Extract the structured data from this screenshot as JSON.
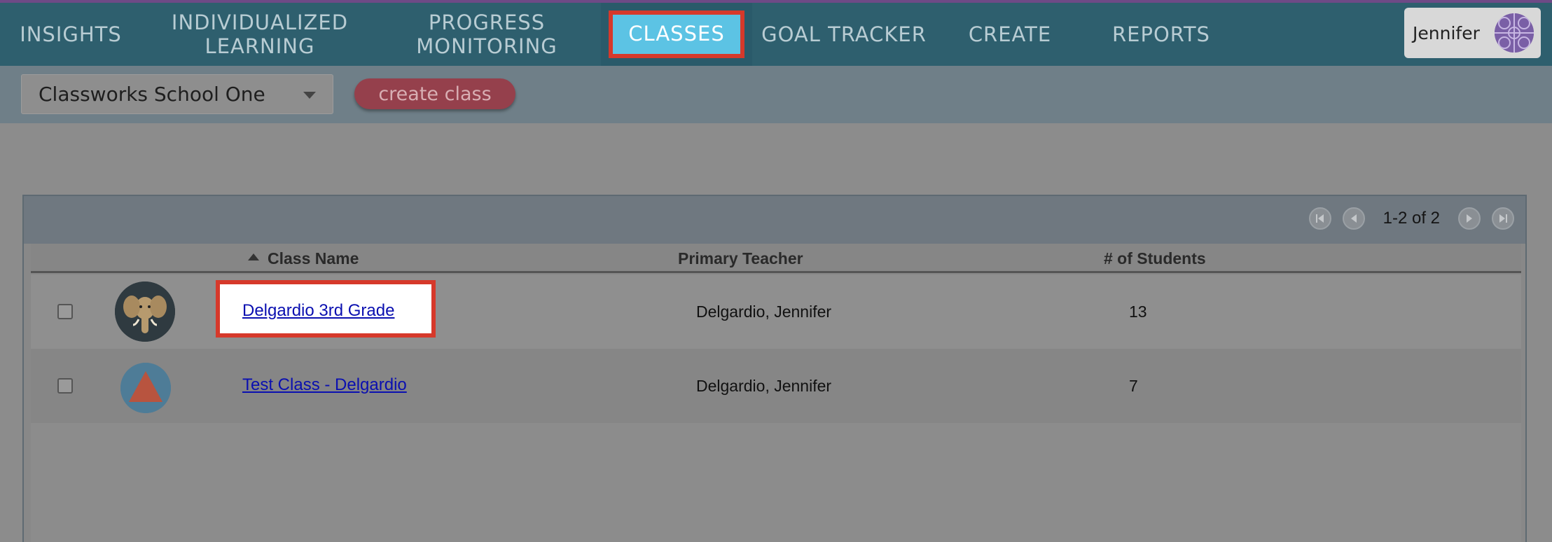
{
  "nav": {
    "items": [
      {
        "label": "INSIGHTS"
      },
      {
        "label": "INDIVIDUALIZED LEARNING"
      },
      {
        "label": "PROGRESS MONITORING"
      },
      {
        "label": "CLASSES"
      },
      {
        "label": "GOAL TRACKER"
      },
      {
        "label": "CREATE"
      },
      {
        "label": "REPORTS"
      }
    ],
    "active": "CLASSES",
    "user": {
      "name": "Jennifer"
    }
  },
  "toolbar": {
    "school_select": {
      "value": "Classworks School One"
    },
    "create_label": "create class"
  },
  "table": {
    "pager_text": "1-2 of 2",
    "headers": {
      "class_name": "Class Name",
      "teacher": "Primary Teacher",
      "students": "# of Students"
    },
    "rows": [
      {
        "class_name": "Delgardio 3rd Grade",
        "teacher": "Delgardio, Jennifer",
        "students": "13",
        "icon": "elephant-icon"
      },
      {
        "class_name": "Test Class - Delgardio",
        "teacher": "Delgardio, Jennifer",
        "students": "7",
        "icon": "triangle-icon"
      }
    ]
  },
  "colors": {
    "nav_bg": "#2e5f6e",
    "active_tab": "#5cc3e4",
    "highlight_border": "#d6392b",
    "create_button": "#95404c",
    "link": "#0a0fb0"
  }
}
